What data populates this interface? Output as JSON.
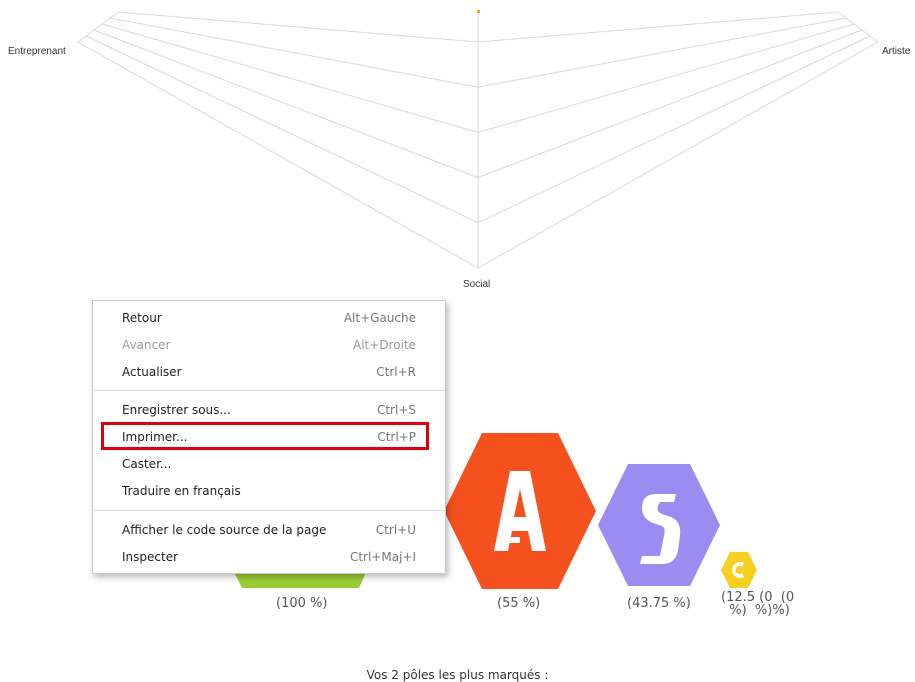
{
  "radar": {
    "labels": {
      "entreprenant": "Entreprenant",
      "artiste": "Artiste",
      "social": "Social"
    },
    "grid_color": "#d9d9d9"
  },
  "poles": [
    {
      "letter": "",
      "color": "#9acd32",
      "percent": "(100 %)"
    },
    {
      "letter": "A",
      "color": "#f4511e",
      "percent": "(55 %)"
    },
    {
      "letter": "S",
      "color": "#9b8cf2",
      "percent": "(43.75 %)"
    },
    {
      "letter": "C",
      "color": "#f5d020",
      "percent": "(12.5 (0  (0\n  %)  %)%)"
    }
  ],
  "summary": "Vos 2 pôles les plus marqués :",
  "context_menu": {
    "items": [
      {
        "label": "Retour",
        "shortcut": "Alt+Gauche",
        "disabled": false
      },
      {
        "label": "Avancer",
        "shortcut": "Alt+Droite",
        "disabled": true
      },
      {
        "label": "Actualiser",
        "shortcut": "Ctrl+R",
        "disabled": false
      },
      {
        "label": "Enregistrer sous...",
        "shortcut": "Ctrl+S",
        "disabled": false
      },
      {
        "label": "Imprimer...",
        "shortcut": "Ctrl+P",
        "disabled": false
      },
      {
        "label": "Caster...",
        "shortcut": "",
        "disabled": false
      },
      {
        "label": "Traduire en français",
        "shortcut": "",
        "disabled": false
      },
      {
        "label": "Afficher le code source de la page",
        "shortcut": "Ctrl+U",
        "disabled": false
      },
      {
        "label": "Inspecter",
        "shortcut": "Ctrl+Maj+I",
        "disabled": false
      }
    ],
    "highlight_color": "#e0000d"
  }
}
